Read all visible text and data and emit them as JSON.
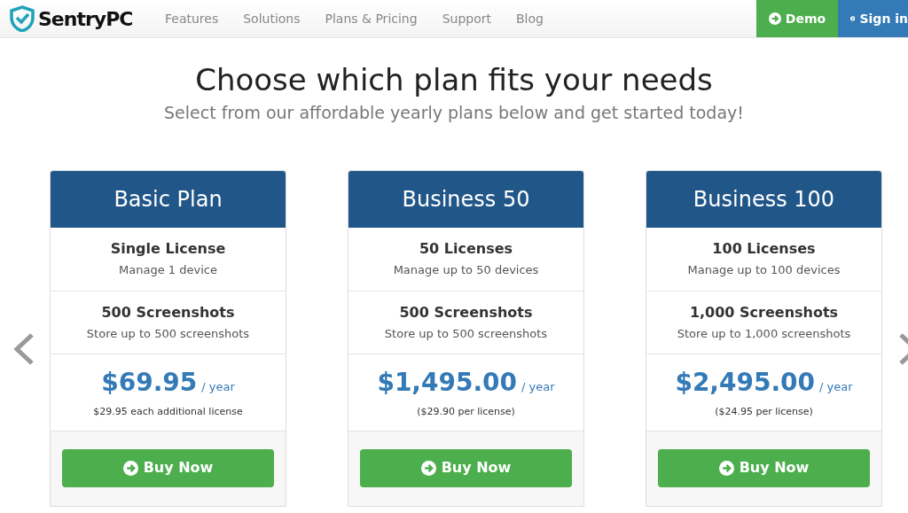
{
  "nav": {
    "brand": "SentryPC",
    "links": [
      "Features",
      "Solutions",
      "Plans & Pricing",
      "Support",
      "Blog"
    ],
    "demo": "Demo",
    "signin": "Sign in"
  },
  "heading": "Choose which plan fits your needs",
  "subheading": "Select from our affordable yearly plans below and get started today!",
  "plans": [
    {
      "name": "Basic Plan",
      "licenses": "Single License",
      "licenses_note": "Manage 1 device",
      "screenshots": "500 Screenshots",
      "screenshots_note": "Store up to 500 screenshots",
      "price": "$69.95",
      "period": "/ year",
      "price_note": "$29.95 each additional license",
      "button": "Buy Now"
    },
    {
      "name": "Business 50",
      "licenses": "50 Licenses",
      "licenses_note": "Manage up to 50 devices",
      "screenshots": "500 Screenshots",
      "screenshots_note": "Store up to 500 screenshots",
      "price": "$1,495.00",
      "period": "/ year",
      "price_note": "($29.90 per license)",
      "button": "Buy Now"
    },
    {
      "name": "Business 100",
      "licenses": "100 Licenses",
      "licenses_note": "Manage up to 100 devices",
      "screenshots": "1,000 Screenshots",
      "screenshots_note": "Store up to 1,000 screenshots",
      "price": "$2,495.00",
      "period": "/ year",
      "price_note": "($24.95 per license)",
      "button": "Buy Now"
    }
  ]
}
